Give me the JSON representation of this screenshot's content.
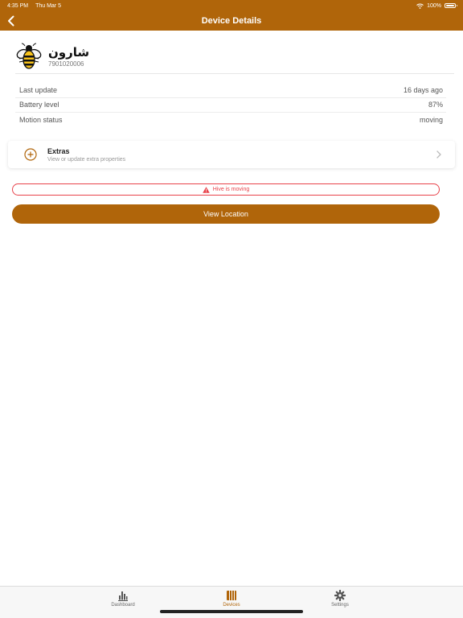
{
  "status_bar": {
    "time": "4:35 PM",
    "date": "Thu Mar 5",
    "battery": "100%",
    "battery_level": 1.0
  },
  "nav": {
    "title": "Device Details",
    "back_icon": "chevron-left-icon"
  },
  "device": {
    "name": "شارون",
    "id": "7901020006",
    "icon": "bee-icon"
  },
  "info_rows": [
    {
      "label": "Last update",
      "value": "16 days ago"
    },
    {
      "label": "Battery level",
      "value": "87%"
    },
    {
      "label": "Motion status",
      "value": "moving"
    }
  ],
  "extras": {
    "title": "Extras",
    "subtitle": "View or update extra properties",
    "icon": "plus-circle-icon"
  },
  "alert": {
    "text": "Hive is moving",
    "icon": "warning-icon"
  },
  "view_location_label": "View Location",
  "tabs": [
    {
      "label": "Dashboard",
      "icon": "bar-chart-icon",
      "active": false
    },
    {
      "label": "Devices",
      "icon": "hives-icon",
      "active": true
    },
    {
      "label": "Settings",
      "icon": "gear-icon",
      "active": false
    }
  ],
  "colors": {
    "accent": "#b0650a",
    "alert": "#e8434b"
  }
}
